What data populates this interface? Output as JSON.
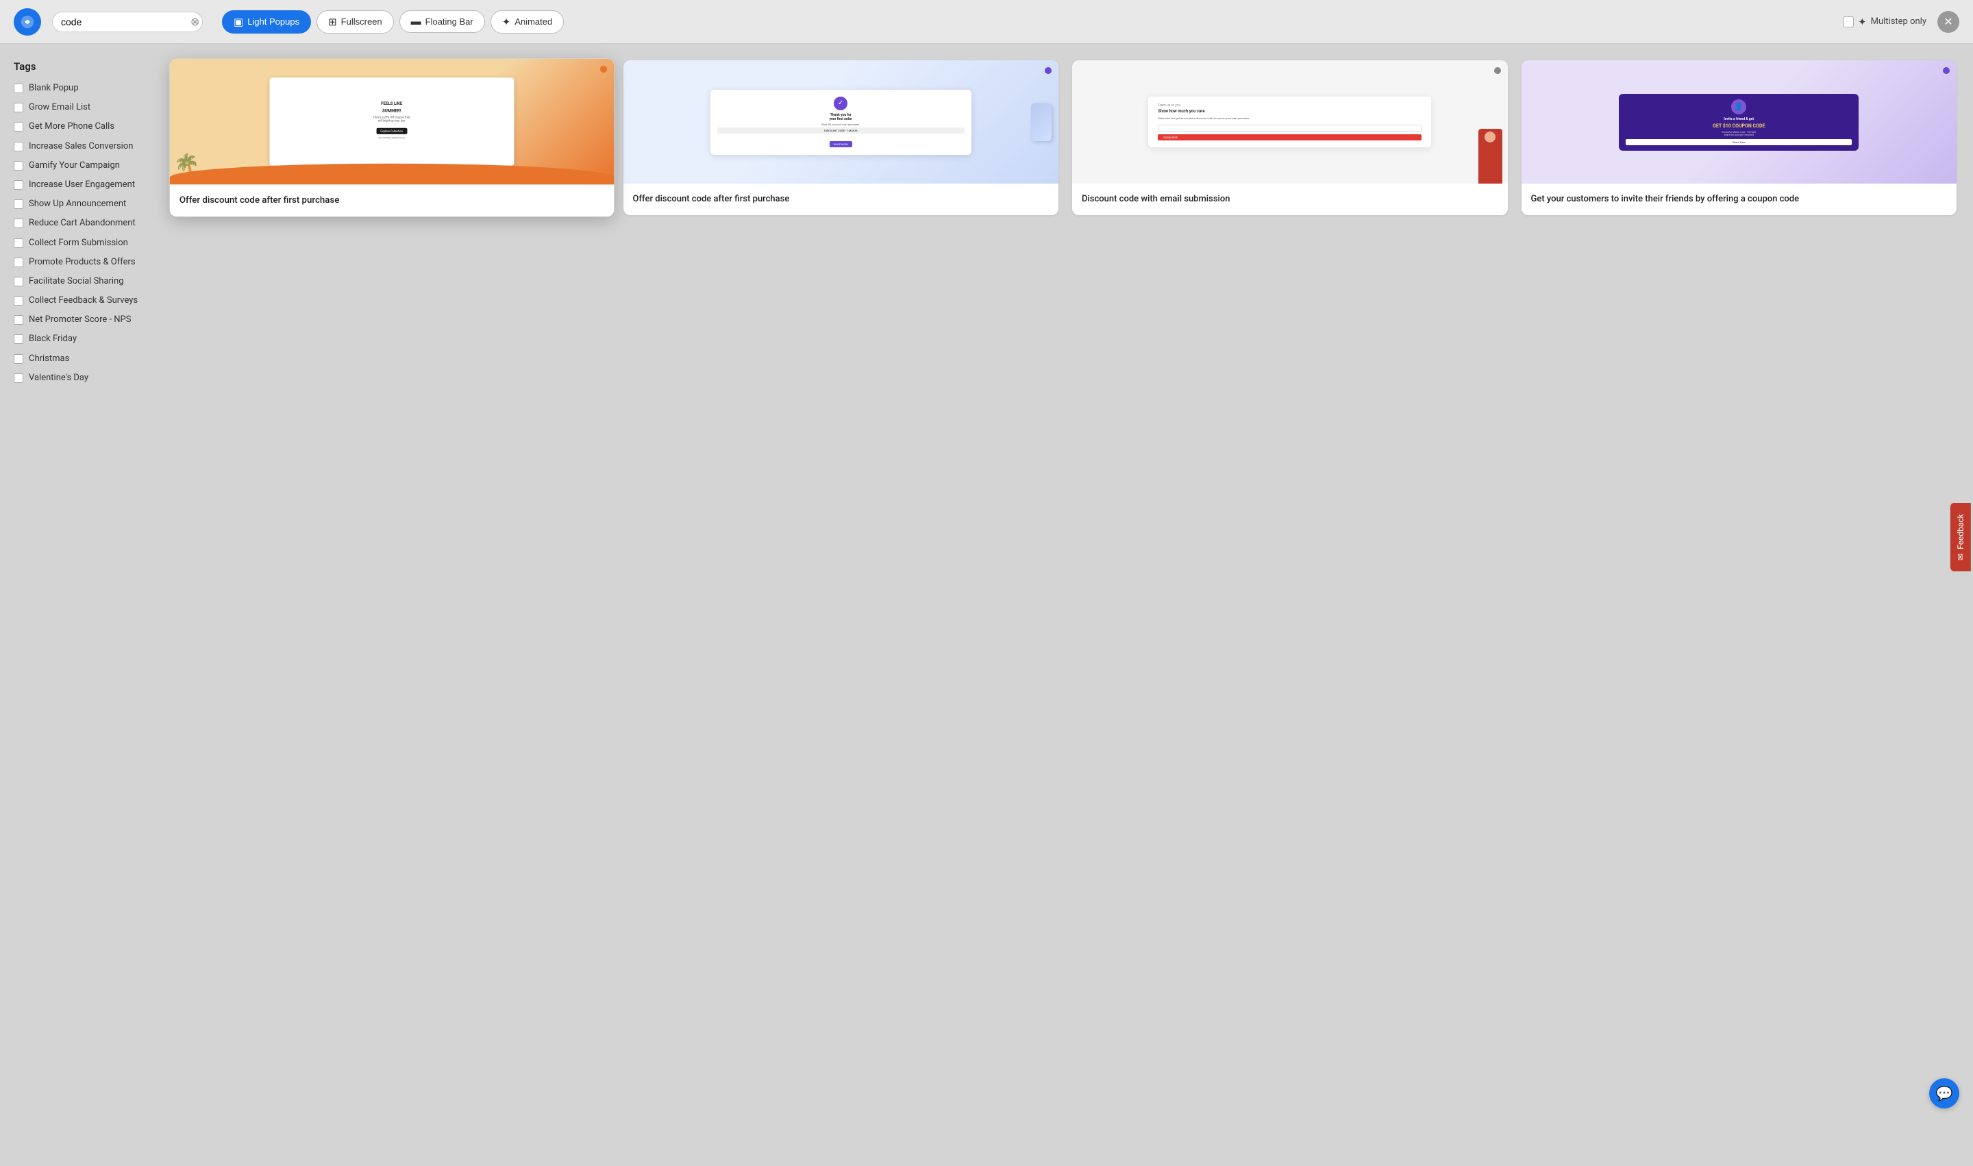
{
  "header": {
    "search_placeholder": "code",
    "search_value": "code",
    "filters": [
      {
        "id": "light-popups",
        "label": "Light Popups",
        "icon": "▣",
        "active": true
      },
      {
        "id": "fullscreen",
        "label": "Fullscreen",
        "icon": "⊞",
        "active": false
      },
      {
        "id": "floating-bar",
        "label": "Floating Bar",
        "icon": "▬",
        "active": false
      },
      {
        "id": "animated",
        "label": "Animated",
        "icon": "✦",
        "active": false
      },
      {
        "id": "multistep",
        "label": "Multistep only",
        "icon": "",
        "active": false
      }
    ]
  },
  "sidebar": {
    "title": "Tags",
    "tags": [
      {
        "id": "blank-popup",
        "label": "Blank Popup",
        "checked": false
      },
      {
        "id": "grow-email-list",
        "label": "Grow Email List",
        "checked": false
      },
      {
        "id": "get-more-phone-calls",
        "label": "Get More Phone Calls",
        "checked": false
      },
      {
        "id": "increase-sales-conversion",
        "label": "Increase Sales Conversion",
        "checked": false
      },
      {
        "id": "gamify-your-campaign",
        "label": "Gamify Your Campaign",
        "checked": false
      },
      {
        "id": "increase-user-engagement",
        "label": "Increase User Engagement",
        "checked": false
      },
      {
        "id": "show-up-announcement",
        "label": "Show Up Announcement",
        "checked": false
      },
      {
        "id": "reduce-cart-abandonment",
        "label": "Reduce Cart Abandonment",
        "checked": false
      },
      {
        "id": "collect-form-submission",
        "label": "Collect Form Submission",
        "checked": false
      },
      {
        "id": "promote-products-offers",
        "label": "Promote Products & Offers",
        "checked": false
      },
      {
        "id": "facilitate-social-sharing",
        "label": "Facilitate Social Sharing",
        "checked": false
      },
      {
        "id": "collect-feedback-surveys",
        "label": "Collect Feedback & Surveys",
        "checked": false
      },
      {
        "id": "net-promoter-score",
        "label": "Net Promoter Score - NPS",
        "checked": false
      },
      {
        "id": "black-friday",
        "label": "Black Friday",
        "checked": false
      },
      {
        "id": "christmas",
        "label": "Christmas",
        "checked": false
      },
      {
        "id": "valentines-day",
        "label": "Valentine's Day",
        "checked": false
      }
    ]
  },
  "templates": [
    {
      "id": "template-1",
      "title": "Offer discount code after first purchase",
      "highlighted": true,
      "dot_color": "orange"
    },
    {
      "id": "template-2",
      "title": "Offer discount code after first purchase",
      "highlighted": false,
      "dot_color": "purple"
    },
    {
      "id": "template-3",
      "title": "Discount code with email submission",
      "highlighted": false,
      "dot_color": "gray"
    },
    {
      "id": "template-4",
      "title": "Get your customers to invite their friends by offering a coupon code",
      "highlighted": false,
      "dot_color": "purple"
    }
  ],
  "feedback": {
    "label": "Feedback"
  },
  "chat": {
    "icon": "💬"
  }
}
